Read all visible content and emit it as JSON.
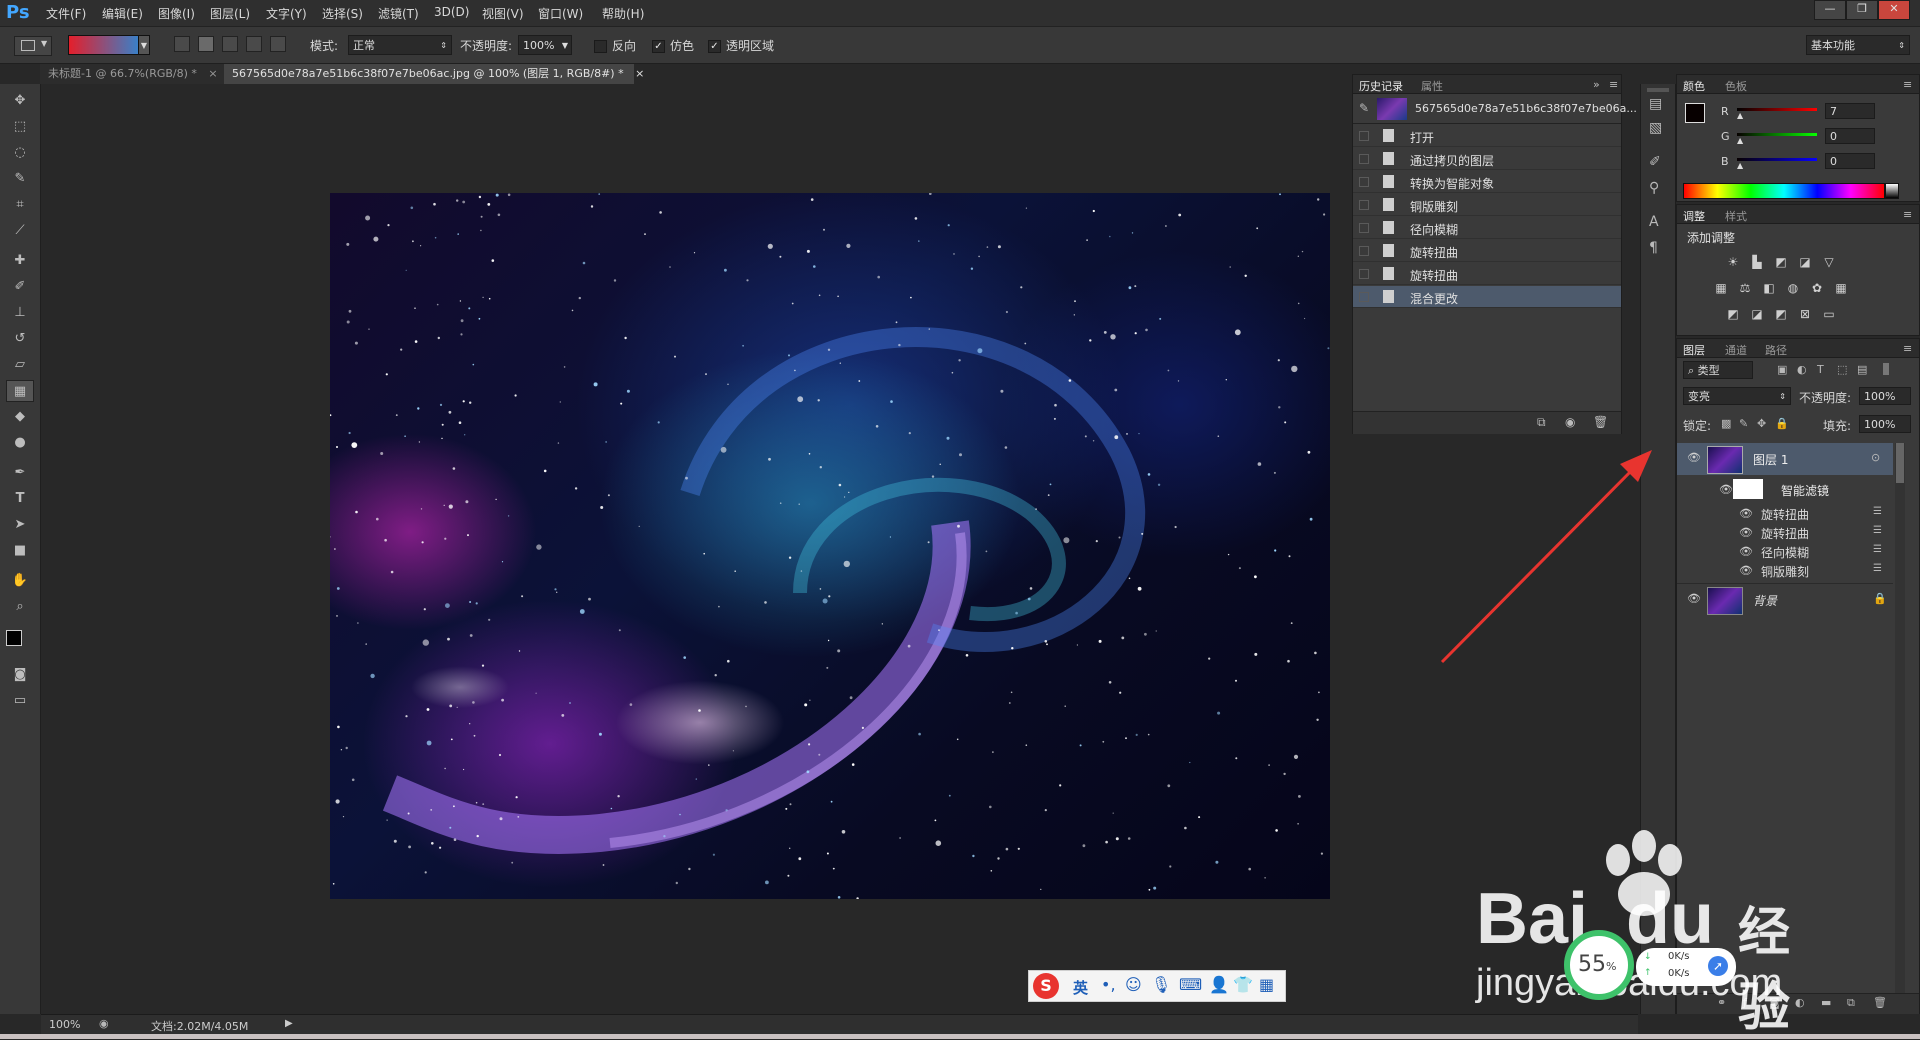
{
  "app": {
    "logo": "Ps"
  },
  "menu": [
    "文件(F)",
    "编辑(E)",
    "图像(I)",
    "图层(L)",
    "文字(Y)",
    "选择(S)",
    "滤镜(T)",
    "3D(D)",
    "视图(V)",
    "窗口(W)",
    "帮助(H)"
  ],
  "window_controls": {
    "minimize": "—",
    "restore": "❐",
    "close": "✕"
  },
  "options": {
    "mode_label": "模式:",
    "mode_value": "正常",
    "opacity_label": "不透明度:",
    "opacity_value": "100%",
    "reverse_label": "反向",
    "dither_label": "仿色",
    "transparency_label": "透明区域",
    "reverse_checked": false,
    "dither_checked": true,
    "transparency_checked": true,
    "workspace": "基本功能",
    "gradient_colors": [
      "#e41f2b",
      "#1f8fe0"
    ]
  },
  "tabs": [
    {
      "label": "未标题-1 @ 66.7%(RGB/8) *",
      "close": "×",
      "active": false
    },
    {
      "label": "567565d0e78a7e51b6c38f07e7be06ac.jpg @ 100% (图层 1, RGB/8#) *",
      "close": "×",
      "active": true
    }
  ],
  "history": {
    "tabs": [
      "历史记录",
      "属性"
    ],
    "snapshot": "567565d0e78a7e51b6c38f07e7be06a...",
    "items": [
      "打开",
      "通过拷贝的图层",
      "转换为智能对象",
      "铜版雕刻",
      "径向模糊",
      "旋转扭曲",
      "旋转扭曲",
      "混合更改"
    ],
    "selected_index": 7
  },
  "color": {
    "tabs": [
      "颜色",
      "色板"
    ],
    "r_label": "R",
    "g_label": "G",
    "b_label": "B",
    "r": "7",
    "g": "0",
    "b": "0"
  },
  "adjustments": {
    "tabs": [
      "调整",
      "样式"
    ],
    "title": "添加调整"
  },
  "layers": {
    "tabs": [
      "图层",
      "通道",
      "路径"
    ],
    "filter_kind": "类型",
    "blend_mode": "变亮",
    "opacity_label": "不透明度:",
    "opacity_value": "100%",
    "lock_label": "锁定:",
    "fill_label": "填充:",
    "fill_value": "100%",
    "layer1": "图层 1",
    "smart_filters": "智能滤镜",
    "filters": [
      "旋转扭曲",
      "旋转扭曲",
      "径向模糊",
      "铜版雕刻"
    ],
    "background": "背景"
  },
  "status": {
    "zoom": "100%",
    "doc": "文档:2.02M/4.05M"
  },
  "ime": {
    "lang": "英"
  },
  "net": {
    "percent": "55",
    "unit": "%",
    "speed": "0K/s",
    "speed2": "0K/s"
  },
  "watermark": {
    "brand": "Bai",
    "brand2": "du",
    "cn": "经验",
    "url": "jingyan.baidu.com"
  },
  "colors": {
    "accent": "#e8342f",
    "ps_blue": "#43a7ff",
    "selected_row": "#4d5a6c"
  }
}
